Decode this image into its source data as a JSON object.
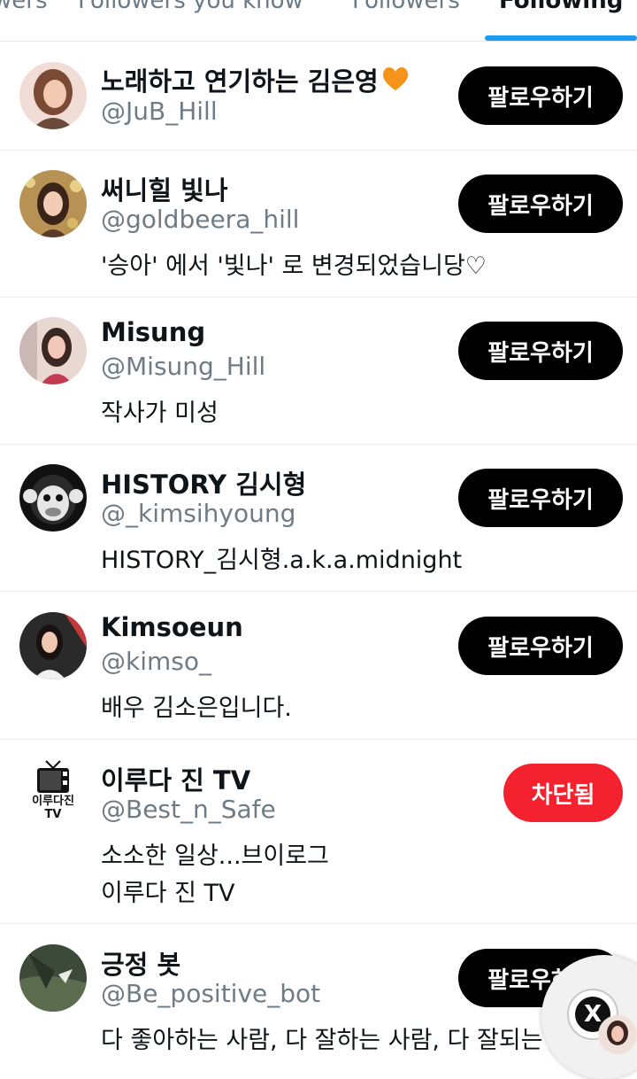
{
  "tabs": [
    {
      "label": "wers"
    },
    {
      "label": "Followers you know"
    },
    {
      "label": "Followers"
    },
    {
      "label": "Following",
      "active": true
    }
  ],
  "follow_label": "팔로우하기",
  "blocked_label": "차단됨",
  "users": [
    {
      "name": "노래하고 연기하는 김은영",
      "name_emoji": "orange-heart",
      "handle": "@JuB_Hill",
      "bio": [],
      "button": "follow"
    },
    {
      "name": "써니힐 빛나",
      "handle": "@goldbeera_hill",
      "bio": [
        "'승아' 에서 '빛나' 로 변경되었습니당♡"
      ],
      "button": "follow"
    },
    {
      "name": "Misung",
      "handle": "@Misung_Hill",
      "bio": [
        "작사가 미성"
      ],
      "button": "follow"
    },
    {
      "name": "HISTORY 김시형",
      "handle": "@_kimsihyoung",
      "bio": [
        "HISTORY_김시형.a.k.a.midnight"
      ],
      "button": "follow"
    },
    {
      "name": "Kimsoeun",
      "handle": "@kimso_",
      "bio": [
        "배우 김소은입니다."
      ],
      "button": "follow"
    },
    {
      "name": "이루다 진 TV",
      "handle": "@Best_n_Safe",
      "bio": [
        "소소한 일상...브이로그",
        "이루다 진 TV"
      ],
      "button": "blocked",
      "avatar_text": [
        "이루다진",
        "TV"
      ]
    },
    {
      "name": "긍정 봇",
      "handle": "@Be_positive_bot",
      "bio": [
        "다 좋아하는 사람, 다 잘하는 사람, 다 잘되는"
      ],
      "button": "follow"
    }
  ],
  "fab": {
    "icon": "x-logo-icon",
    "label": "X"
  },
  "colors": {
    "accent": "#1d9bf0",
    "blocked": "#f4212e",
    "button": "#000000",
    "muted": "#6f7b85"
  }
}
